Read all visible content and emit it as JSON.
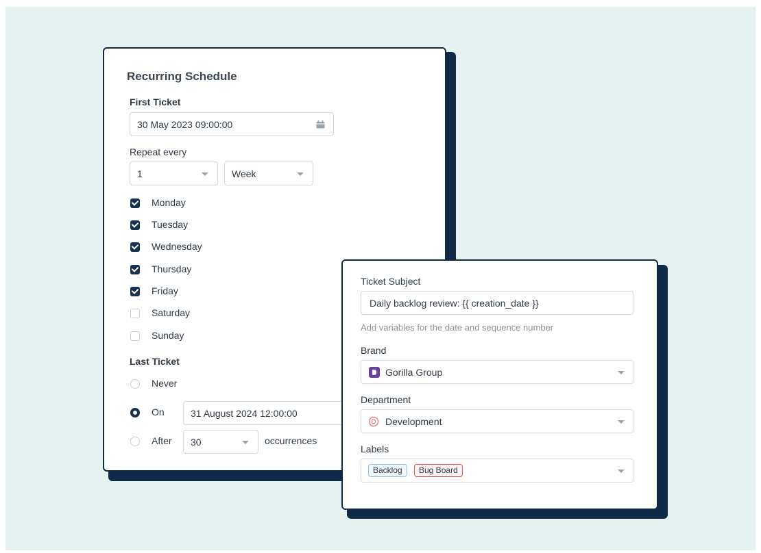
{
  "schedule": {
    "title": "Recurring Schedule",
    "first_ticket_label": "First Ticket",
    "first_ticket_value": "30 May 2023 09:00:00",
    "repeat_label": "Repeat every",
    "repeat_count": "1",
    "repeat_unit": "Week",
    "days": [
      {
        "label": "Monday",
        "checked": true
      },
      {
        "label": "Tuesday",
        "checked": true
      },
      {
        "label": "Wednesday",
        "checked": true
      },
      {
        "label": "Thursday",
        "checked": true
      },
      {
        "label": "Friday",
        "checked": true
      },
      {
        "label": "Saturday",
        "checked": false
      },
      {
        "label": "Sunday",
        "checked": false
      }
    ],
    "last_ticket_label": "Last Ticket",
    "last_ticket_options": {
      "never": "Never",
      "on": "On",
      "on_value": "31 August 2024 12:00:00",
      "after": "After",
      "after_count": "30",
      "occurrences": "occurrences",
      "selected": "on"
    }
  },
  "ticket": {
    "subject_label": "Ticket Subject",
    "subject_value": "Daily backlog review: {{ creation_date }}",
    "subject_hint": "Add variables for the date and sequence number",
    "brand_label": "Brand",
    "brand_value": "Gorilla Group",
    "department_label": "Department",
    "department_value": "Development",
    "department_initial": "D",
    "labels_label": "Labels",
    "labels": [
      {
        "text": "Backlog",
        "color": "#8fc1e8"
      },
      {
        "text": "Bug Board",
        "color": "#e0524f"
      }
    ]
  },
  "colors": {
    "background": "#e5f2f1",
    "card_border": "#0e2a47",
    "checkbox": "#16324f",
    "brand_icon": "#6b3fa0",
    "department_icon": "#e0524f"
  }
}
